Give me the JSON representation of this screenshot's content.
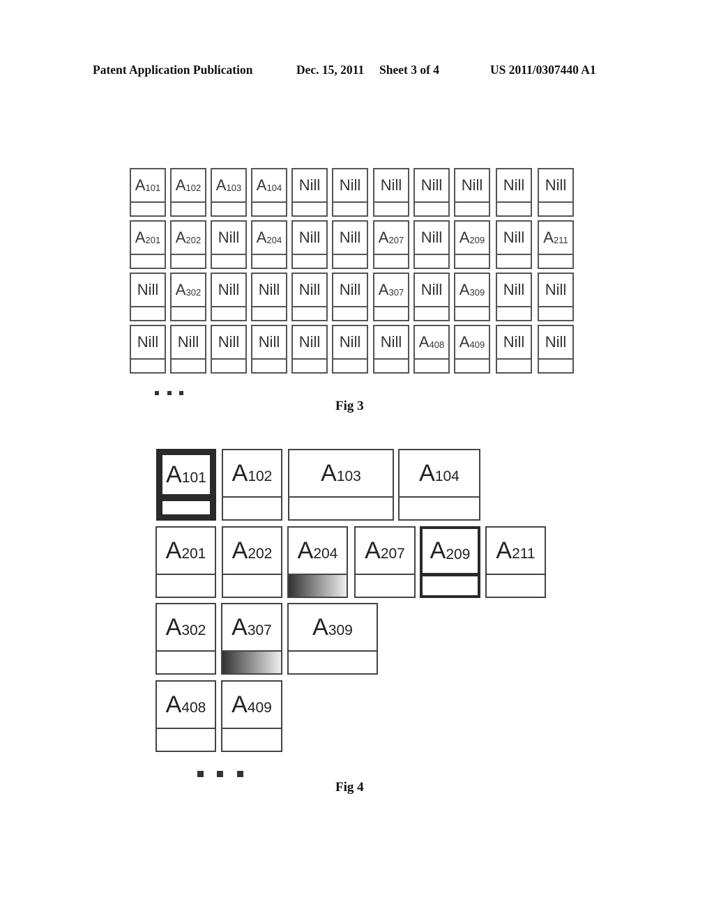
{
  "header": {
    "publication": "Patent Application Publication",
    "date": "Dec. 15, 2011",
    "sheet": "Sheet 3 of 4",
    "number": "US 2011/0307440 A1"
  },
  "fig3": {
    "caption": "Fig 3",
    "continuation": "...",
    "rows": [
      [
        {
          "p": "A",
          "s": "101"
        },
        {
          "p": "A",
          "s": "102"
        },
        {
          "p": "A",
          "s": "103"
        },
        {
          "p": "A",
          "s": "104"
        },
        {
          "p": "Nill",
          "s": ""
        },
        {
          "p": "Nill",
          "s": ""
        },
        {
          "p": "Nill",
          "s": ""
        },
        {
          "p": "Nill",
          "s": ""
        },
        {
          "p": "Nill",
          "s": ""
        },
        {
          "p": "Nill",
          "s": ""
        },
        {
          "p": "Nill",
          "s": ""
        }
      ],
      [
        {
          "p": "A",
          "s": "201"
        },
        {
          "p": "A",
          "s": "202"
        },
        {
          "p": "Nill",
          "s": ""
        },
        {
          "p": "A",
          "s": "204"
        },
        {
          "p": "Nill",
          "s": ""
        },
        {
          "p": "Nill",
          "s": ""
        },
        {
          "p": "A",
          "s": "207"
        },
        {
          "p": "Nill",
          "s": ""
        },
        {
          "p": "A",
          "s": "209"
        },
        {
          "p": "Nill",
          "s": ""
        },
        {
          "p": "A",
          "s": "211"
        }
      ],
      [
        {
          "p": "Nill",
          "s": ""
        },
        {
          "p": "A",
          "s": "302"
        },
        {
          "p": "Nill",
          "s": ""
        },
        {
          "p": "Nill",
          "s": ""
        },
        {
          "p": "Nill",
          "s": ""
        },
        {
          "p": "Nill",
          "s": ""
        },
        {
          "p": "A",
          "s": "307"
        },
        {
          "p": "Nill",
          "s": ""
        },
        {
          "p": "A",
          "s": "309"
        },
        {
          "p": "Nill",
          "s": ""
        },
        {
          "p": "Nill",
          "s": ""
        }
      ],
      [
        {
          "p": "Nill",
          "s": ""
        },
        {
          "p": "Nill",
          "s": ""
        },
        {
          "p": "Nill",
          "s": ""
        },
        {
          "p": "Nill",
          "s": ""
        },
        {
          "p": "Nill",
          "s": ""
        },
        {
          "p": "Nill",
          "s": ""
        },
        {
          "p": "Nill",
          "s": ""
        },
        {
          "p": "A",
          "s": "408"
        },
        {
          "p": "A",
          "s": "409"
        },
        {
          "p": "Nill",
          "s": ""
        },
        {
          "p": "Nill",
          "s": ""
        }
      ]
    ]
  },
  "fig4": {
    "caption": "Fig 4",
    "continuation": "...",
    "cells": [
      {
        "p": "A",
        "s": "101",
        "style": "thick"
      },
      {
        "p": "A",
        "s": "102",
        "style": "normal"
      },
      {
        "p": "A",
        "s": "103",
        "style": "normal"
      },
      {
        "p": "A",
        "s": "104",
        "style": "normal"
      },
      {
        "p": "A",
        "s": "201",
        "style": "normal"
      },
      {
        "p": "A",
        "s": "202",
        "style": "normal"
      },
      {
        "p": "A",
        "s": "204",
        "style": "gradient"
      },
      {
        "p": "A",
        "s": "207",
        "style": "normal"
      },
      {
        "p": "A",
        "s": "209",
        "style": "medium"
      },
      {
        "p": "A",
        "s": "211",
        "style": "normal"
      },
      {
        "p": "A",
        "s": "302",
        "style": "normal"
      },
      {
        "p": "A",
        "s": "307",
        "style": "gradient"
      },
      {
        "p": "A",
        "s": "309",
        "style": "normal"
      },
      {
        "p": "A",
        "s": "408",
        "style": "normal"
      },
      {
        "p": "A",
        "s": "409",
        "style": "normal"
      }
    ]
  }
}
